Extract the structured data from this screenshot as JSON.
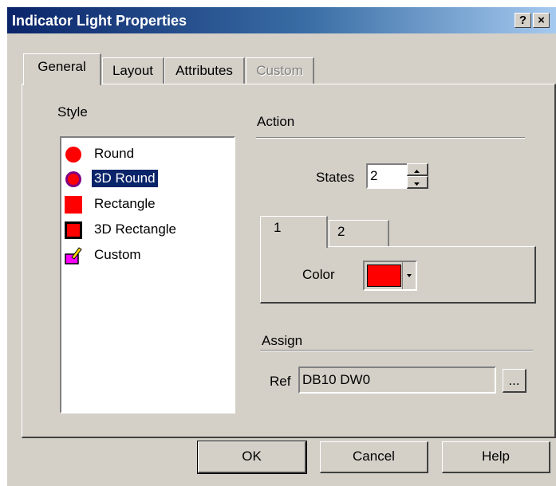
{
  "window": {
    "title": "Indicator Light Properties",
    "help_button": "?",
    "close_button": "×"
  },
  "tabs": [
    {
      "label": "General",
      "active": true
    },
    {
      "label": "Layout",
      "active": false
    },
    {
      "label": "Attributes",
      "active": false
    },
    {
      "label": "Custom",
      "disabled": true
    }
  ],
  "style": {
    "label": "Style",
    "items": [
      {
        "label": "Round",
        "icon": "red-circle-icon"
      },
      {
        "label": "3D Round",
        "icon": "3d-circle-icon",
        "selected": true
      },
      {
        "label": "Rectangle",
        "icon": "red-square-icon"
      },
      {
        "label": "3D Rectangle",
        "icon": "3d-square-icon"
      },
      {
        "label": "Custom",
        "icon": "custom-paint-icon"
      }
    ]
  },
  "action": {
    "label": "Action",
    "states_label": "States",
    "states_value": "2",
    "state_tabs": [
      "1",
      "2"
    ],
    "color_label": "Color",
    "color_value": "#ff0000"
  },
  "assign": {
    "label": "Assign",
    "ref_label": "Ref",
    "ref_value": "DB10 DW0",
    "browse_label": "..."
  },
  "buttons": {
    "ok": "OK",
    "cancel": "Cancel",
    "help": "Help"
  },
  "colors": {
    "title_start": "#0a246a",
    "title_end": "#a6caf0",
    "selection": "#0a246a",
    "face": "#d4d0c8"
  }
}
